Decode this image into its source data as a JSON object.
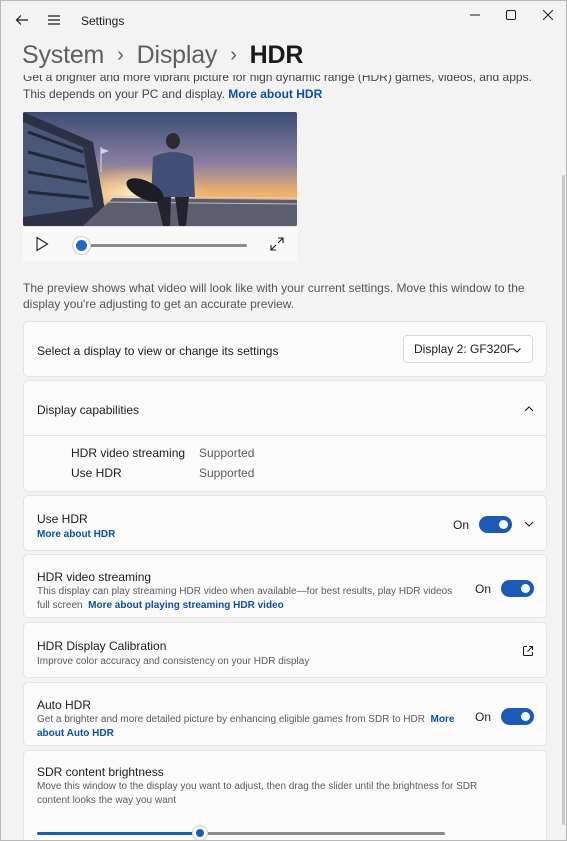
{
  "app": {
    "title": "Settings"
  },
  "breadcrumb": {
    "items": [
      "System",
      "Display"
    ],
    "current": "HDR"
  },
  "intro": {
    "text": "Get a brighter and more vibrant picture for high dynamic range (HDR) games, videos, and apps. This depends on your PC and display.",
    "link": "More about HDR"
  },
  "preview_note": "The preview shows what video will look like with your current settings. Move this window to the display you're adjusting to get an accurate preview.",
  "video": {
    "progress": 0.0
  },
  "display_select": {
    "label": "Select a display to view or change its settings",
    "value": "Display 2: GF320F"
  },
  "capabilities": {
    "title": "Display capabilities",
    "rows": [
      {
        "name": "HDR video streaming",
        "value": "Supported"
      },
      {
        "name": "Use HDR",
        "value": "Supported"
      }
    ]
  },
  "use_hdr": {
    "title": "Use HDR",
    "link": "More about HDR",
    "toggle_label": "On"
  },
  "hdr_streaming": {
    "title": "HDR video streaming",
    "desc": "This display can play streaming HDR video when available—for best results, play HDR videos full screen",
    "link": "More about playing streaming HDR video",
    "toggle_label": "On"
  },
  "calibration": {
    "title": "HDR Display Calibration",
    "desc": "Improve color accuracy and consistency on your HDR display"
  },
  "auto_hdr": {
    "title": "Auto HDR",
    "desc": "Get a brighter and more detailed picture by enhancing eligible games from SDR to HDR",
    "link": "More about Auto HDR",
    "toggle_label": "On"
  },
  "sdr_brightness": {
    "title": "SDR content brightness",
    "desc": "Move this window to the display you want to adjust, then drag the slider until the brightness for SDR content looks the way you want",
    "level": 0.4
  },
  "colors": {
    "accent": "#1b5bb6",
    "link": "#0a4fa8"
  }
}
